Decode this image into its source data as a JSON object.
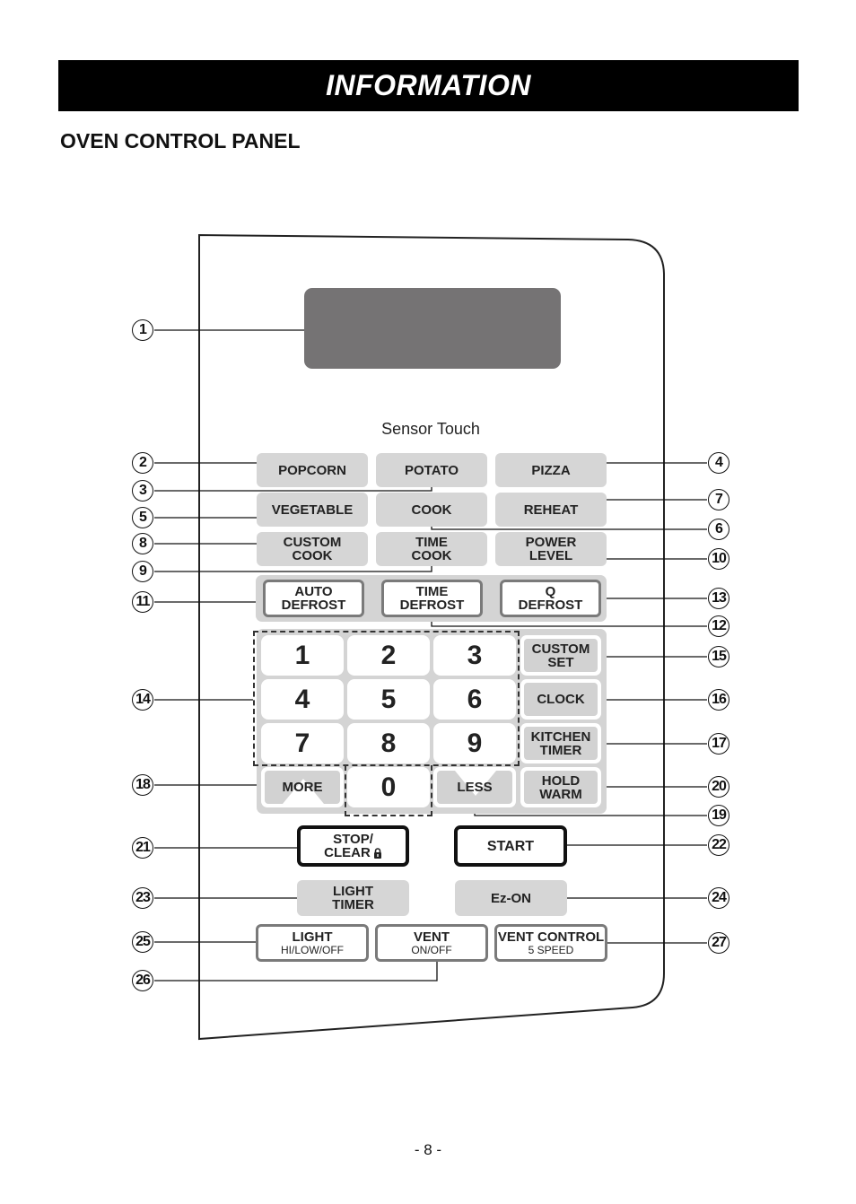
{
  "header": {
    "title": "INFORMATION"
  },
  "section": {
    "title": "OVEN CONTROL PANEL"
  },
  "panel": {
    "sensor_label": "Sensor Touch",
    "sensor_row1": [
      {
        "id": "popcorn",
        "lines": [
          "POPCORN"
        ]
      },
      {
        "id": "potato",
        "lines": [
          "POTATO"
        ]
      },
      {
        "id": "pizza",
        "lines": [
          "PIZZA"
        ]
      }
    ],
    "sensor_row2": [
      {
        "id": "vegetable",
        "lines": [
          "VEGETABLE"
        ]
      },
      {
        "id": "cook",
        "lines": [
          "COOK"
        ]
      },
      {
        "id": "reheat",
        "lines": [
          "REHEAT"
        ]
      }
    ],
    "sensor_row3": [
      {
        "id": "custom-cook",
        "lines": [
          "CUSTOM",
          "COOK"
        ]
      },
      {
        "id": "time-cook",
        "lines": [
          "TIME",
          "COOK"
        ]
      },
      {
        "id": "power-level",
        "lines": [
          "POWER",
          "LEVEL"
        ]
      }
    ],
    "defrost_row": [
      {
        "id": "auto-defrost",
        "lines": [
          "AUTO",
          "DEFROST"
        ]
      },
      {
        "id": "time-defrost",
        "lines": [
          "TIME",
          "DEFROST"
        ]
      },
      {
        "id": "q-defrost",
        "lines": [
          "Q",
          "DEFROST"
        ]
      }
    ],
    "number_keys": [
      "1",
      "2",
      "3",
      "4",
      "5",
      "6",
      "7",
      "8",
      "9",
      "0"
    ],
    "more": "MORE",
    "less": "LESS",
    "side_keys": [
      {
        "id": "custom-set",
        "lines": [
          "CUSTOM",
          "SET"
        ]
      },
      {
        "id": "clock",
        "lines": [
          "CLOCK"
        ]
      },
      {
        "id": "kitchen-timer",
        "lines": [
          "KITCHEN",
          "TIMER"
        ]
      },
      {
        "id": "hold-warm",
        "lines": [
          "HOLD",
          "WARM"
        ]
      }
    ],
    "stop_clear": [
      "STOP/",
      "CLEAR"
    ],
    "start": "START",
    "light_timer": [
      "LIGHT",
      "TIMER"
    ],
    "ez_on": "Ez-ON",
    "light": {
      "title": "LIGHT",
      "sub": "HI/LOW/OFF"
    },
    "vent": {
      "title": "VENT",
      "sub": "ON/OFF"
    },
    "vent_control": {
      "title": "VENT CONTROL",
      "sub": "5 SPEED"
    }
  },
  "callouts": [
    "1",
    "2",
    "3",
    "4",
    "5",
    "6",
    "7",
    "8",
    "9",
    "10",
    "11",
    "12",
    "13",
    "14",
    "15",
    "16",
    "17",
    "18",
    "19",
    "20",
    "21",
    "22",
    "23",
    "24",
    "25",
    "26",
    "27"
  ],
  "footer": {
    "page": "- 8 -"
  }
}
